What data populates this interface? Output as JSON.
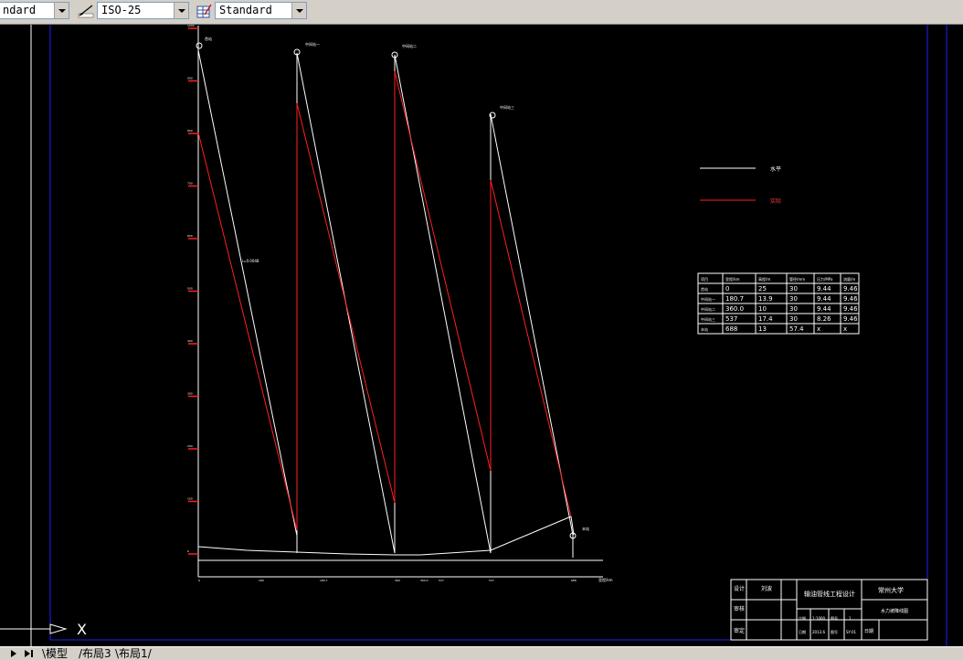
{
  "toolbar": {
    "text_style": "ndard",
    "dim_style": "ISO-25",
    "table_style": "Standard"
  },
  "tabs": {
    "model": "模型",
    "layouts": "布局3",
    "layout1": "布局1"
  },
  "legend": {
    "white_label": "水平",
    "red_label": "实际"
  },
  "table": {
    "headers": [
      "项目",
      "里程/km",
      "高程/m",
      "管径/mm",
      "压力/MPa",
      "流量/m"
    ],
    "rows": [
      [
        "首站",
        "0",
        "25",
        "30",
        "9.44",
        "9.46"
      ],
      [
        "中间站一",
        "180.7",
        "13.9",
        "30",
        "9.44",
        "9.46"
      ],
      [
        "中间站二",
        "360.0",
        "10",
        "30",
        "9.44",
        "9.46"
      ],
      [
        "中间站三",
        "537",
        "17.4",
        "30",
        "8.26",
        "9.46"
      ],
      [
        "末站",
        "688",
        "13",
        "57.4",
        "x",
        "x"
      ]
    ]
  },
  "title_block": {
    "project": "输油管线工程设计",
    "school": "常州大学",
    "drawing": "水力坡降线图",
    "designer_label": "设计",
    "checker_label": "审核",
    "scale_label": "比例",
    "sheet_label": "图号",
    "row5_label": "审定",
    "row6_label": "日期",
    "name": "刘波",
    "scale": "1:1000",
    "sheet_no": "1",
    "date": "2013.6",
    "drawing_no": "SY-01"
  },
  "chart_data": {
    "type": "line",
    "xlabel": "里程/km",
    "x_ticks": [
      "0",
      "180",
      "180.7",
      "360",
      "360.0",
      "537",
      "537",
      "688"
    ],
    "y_ticks": [
      "1000",
      "900",
      "800",
      "700",
      "600",
      "500",
      "400",
      "300",
      "200",
      "100",
      "0"
    ],
    "station_labels": [
      "首站",
      "中间站一",
      "中间站二",
      "中间站三",
      "末站"
    ],
    "series": [
      {
        "name": "水平",
        "color": "#ffffff"
      },
      {
        "name": "实际",
        "color": "#ff2020"
      }
    ],
    "annotation": "i=0.0048"
  },
  "colors": {
    "frame": "#0000ff",
    "white_line": "#ffffff",
    "red_line": "#ff2020",
    "background": "#000000"
  }
}
